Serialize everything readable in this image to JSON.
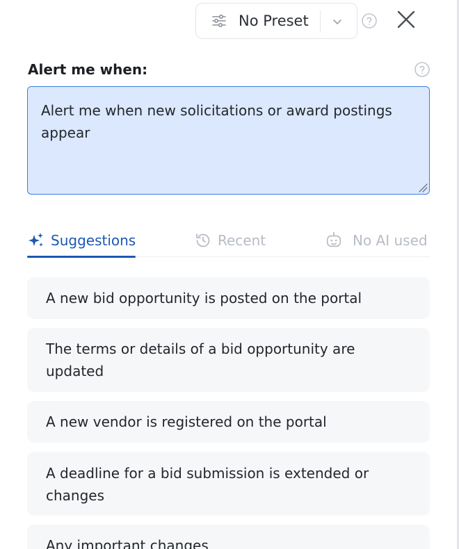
{
  "header": {
    "preset_label": "No Preset",
    "icons": {
      "preset": "sliders-icon",
      "caret": "chevron-down-icon",
      "help": "help-circle-icon",
      "close": "close-icon"
    }
  },
  "alert": {
    "label": "Alert me when:",
    "value": "Alert me when new solicitations or award postings appear"
  },
  "tabs": [
    {
      "label": "Suggestions",
      "icon": "sparkles-icon",
      "active": true
    },
    {
      "label": "Recent",
      "icon": "history-icon",
      "active": false
    },
    {
      "label": "No AI used",
      "icon": "robot-icon",
      "active": false
    }
  ],
  "suggestions": [
    "A new bid opportunity is posted on the portal",
    "The terms or details of a bid opportunity are updated",
    "A new vendor is registered on the portal",
    "A deadline for a bid submission is extended or changes",
    "Any important changes"
  ],
  "colors": {
    "accent": "#1c57b3",
    "textarea_bg": "#dbe8fe",
    "textarea_border": "#3f7bdc",
    "muted": "#b7bcc5",
    "card_bg": "#f6f7f9"
  }
}
